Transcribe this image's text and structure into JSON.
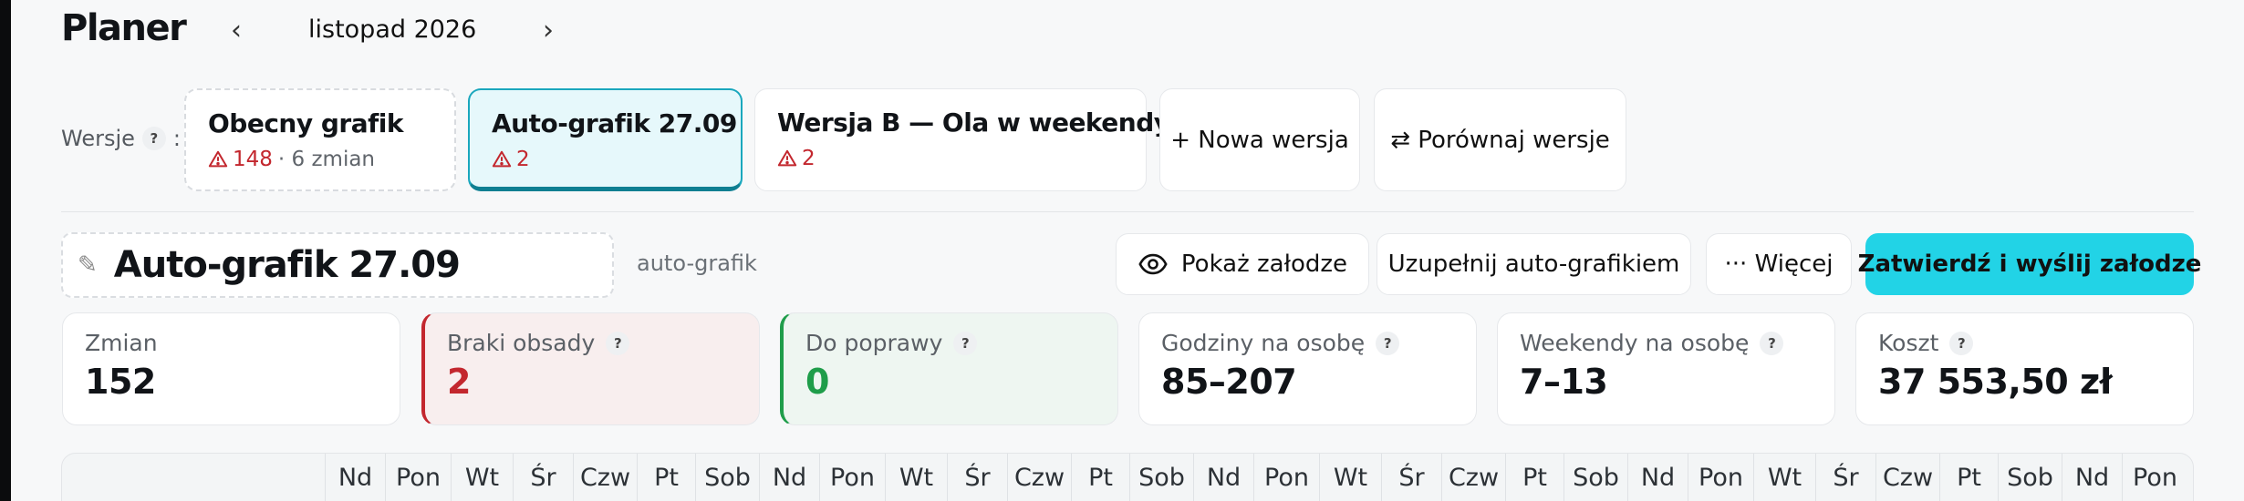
{
  "header": {
    "title": "Planer",
    "month": "listopad 2026",
    "prev_icon": "chevron-left-icon",
    "next_icon": "chevron-right-icon"
  },
  "versions": {
    "label": "Wersje",
    "help": "?",
    "colon": ":",
    "items": [
      {
        "title": "Obecny grafik",
        "warnings": "148",
        "extra": "· 6 zmian",
        "state": "draft"
      },
      {
        "title": "Auto-grafik 27.09",
        "warnings": "2",
        "extra": "",
        "state": "active"
      },
      {
        "title": "Wersja B — Ola w weekendy",
        "warnings": "2",
        "extra": "",
        "state": "normal"
      }
    ],
    "new_version": "+ Nowa wersja",
    "compare": "⇄ Porównaj wersje"
  },
  "schedule": {
    "name": "Auto-grafik 27.09",
    "tag": "auto-grafik",
    "pencil_icon": "pencil-icon",
    "actions": {
      "preview": "Pokaż załodze",
      "fill": "Uzupełnij auto-grafikiem",
      "more": "··· Więcej",
      "confirm": "Zatwierdź i wyślij załodze"
    }
  },
  "stats": [
    {
      "label": "Zmian",
      "value": "152",
      "help": false,
      "status": "neutral"
    },
    {
      "label": "Braki obsady",
      "value": "2",
      "help": true,
      "status": "error"
    },
    {
      "label": "Do poprawy",
      "value": "0",
      "help": true,
      "status": "ok"
    },
    {
      "label": "Godziny na osobę",
      "value": "85–207",
      "help": true,
      "status": "neutral"
    },
    {
      "label": "Weekendy na osobę",
      "value": "7–13",
      "help": true,
      "status": "neutral"
    },
    {
      "label": "Koszt",
      "value": "37 553,50 zł",
      "help": true,
      "status": "neutral"
    }
  ],
  "calendar": {
    "days": [
      "Nd",
      "Pon",
      "Wt",
      "Śr",
      "Czw",
      "Pt",
      "Sob",
      "Nd",
      "Pon",
      "Wt",
      "Śr",
      "Czw",
      "Pt",
      "Sob",
      "Nd",
      "Pon",
      "Wt",
      "Śr",
      "Czw",
      "Pt",
      "Sob",
      "Nd",
      "Pon",
      "Wt",
      "Śr",
      "Czw",
      "Pt",
      "Sob",
      "Nd",
      "Pon"
    ]
  },
  "colors": {
    "accent": "#22d3e6",
    "active_border": "#1aa7bd",
    "error": "#c3272e",
    "success": "#1f9d4a"
  }
}
